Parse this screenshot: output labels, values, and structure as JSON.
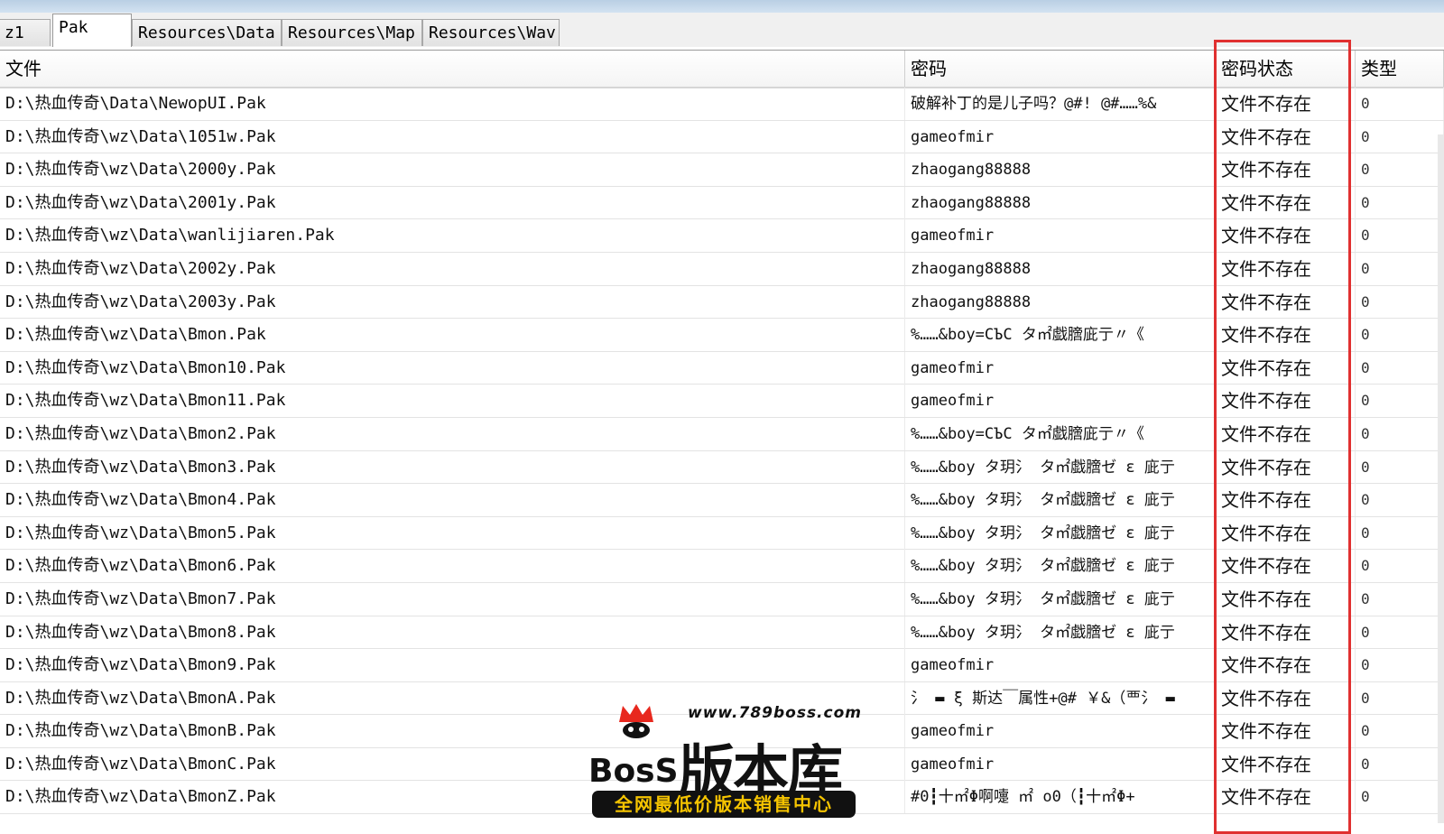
{
  "tabs": [
    {
      "label": "z1",
      "active": false
    },
    {
      "label": "Pak",
      "active": true
    },
    {
      "label": "Resources\\Data",
      "active": false
    },
    {
      "label": "Resources\\Map",
      "active": false
    },
    {
      "label": "Resources\\Wav",
      "active": false
    }
  ],
  "table": {
    "columns": [
      "文件",
      "密码",
      "密码状态",
      "类型"
    ],
    "rows": [
      {
        "file": "D:\\热血传奇\\Data\\NewopUI.Pak",
        "password": "破解补丁的是儿子吗？@#! @#……%&",
        "status": "文件不存在",
        "type": "0"
      },
      {
        "file": "D:\\热血传奇\\wz\\Data\\1051w.Pak",
        "password": "gameofmir",
        "status": "文件不存在",
        "type": "0"
      },
      {
        "file": "D:\\热血传奇\\wz\\Data\\2000y.Pak",
        "password": "zhaogang88888",
        "status": "文件不存在",
        "type": "0"
      },
      {
        "file": "D:\\热血传奇\\wz\\Data\\2001y.Pak",
        "password": "zhaogang88888",
        "status": "文件不存在",
        "type": "0"
      },
      {
        "file": "D:\\热血传奇\\wz\\Data\\wanlijiaren.Pak",
        "password": "gameofmir",
        "status": "文件不存在",
        "type": "0"
      },
      {
        "file": "D:\\热血传奇\\wz\\Data\\2002y.Pak",
        "password": "zhaogang88888",
        "status": "文件不存在",
        "type": "0"
      },
      {
        "file": "D:\\热血传奇\\wz\\Data\\2003y.Pak",
        "password": "zhaogang88888",
        "status": "文件不存在",
        "type": "0"
      },
      {
        "file": "D:\\热血传奇\\wz\\Data\\Bmon.Pak",
        "password": "%……&boy=CЪC   タ㎡戯膪庛亍〃《",
        "status": "文件不存在",
        "type": "0"
      },
      {
        "file": "D:\\热血传奇\\wz\\Data\\Bmon10.Pak",
        "password": "gameofmir",
        "status": "文件不存在",
        "type": "0"
      },
      {
        "file": "D:\\热血传奇\\wz\\Data\\Bmon11.Pak",
        "password": "gameofmir",
        "status": "文件不存在",
        "type": "0"
      },
      {
        "file": "D:\\热血传奇\\wz\\Data\\Bmon2.Pak",
        "password": "%……&boy=CЪC   タ㎡戯膪庛亍〃《",
        "status": "文件不存在",
        "type": "0"
      },
      {
        "file": "D:\\热血传奇\\wz\\Data\\Bmon3.Pak",
        "password": "%……&boy  タ玥氵  タ㎡戯膪ゼ ε 庛亍",
        "status": "文件不存在",
        "type": "0"
      },
      {
        "file": "D:\\热血传奇\\wz\\Data\\Bmon4.Pak",
        "password": "%……&boy  タ玥氵  タ㎡戯膪ゼ ε 庛亍",
        "status": "文件不存在",
        "type": "0"
      },
      {
        "file": "D:\\热血传奇\\wz\\Data\\Bmon5.Pak",
        "password": "%……&boy  タ玥氵  タ㎡戯膪ゼ ε 庛亍",
        "status": "文件不存在",
        "type": "0"
      },
      {
        "file": "D:\\热血传奇\\wz\\Data\\Bmon6.Pak",
        "password": "%……&boy  タ玥氵  タ㎡戯膪ゼ ε 庛亍",
        "status": "文件不存在",
        "type": "0"
      },
      {
        "file": "D:\\热血传奇\\wz\\Data\\Bmon7.Pak",
        "password": "%……&boy  タ玥氵  タ㎡戯膪ゼ ε 庛亍",
        "status": "文件不存在",
        "type": "0"
      },
      {
        "file": "D:\\热血传奇\\wz\\Data\\Bmon8.Pak",
        "password": "%……&boy  タ玥氵  タ㎡戯膪ゼ ε 庛亍",
        "status": "文件不存在",
        "type": "0"
      },
      {
        "file": "D:\\热血传奇\\wz\\Data\\Bmon9.Pak",
        "password": "gameofmir",
        "status": "文件不存在",
        "type": "0"
      },
      {
        "file": "D:\\热血传奇\\wz\\Data\\BmonA.Pak",
        "password": "氵 ▬ ξ 斯达￣属性+@#  ￥&（覀氵 ▬",
        "status": "文件不存在",
        "type": "0"
      },
      {
        "file": "D:\\热血传奇\\wz\\Data\\BmonB.Pak",
        "password": "gameofmir",
        "status": "文件不存在",
        "type": "0"
      },
      {
        "file": "D:\\热血传奇\\wz\\Data\\BmonC.Pak",
        "password": "gameofmir",
        "status": "文件不存在",
        "type": "0"
      },
      {
        "file": "D:\\热血传奇\\wz\\Data\\BmonZ.Pak",
        "password": "#0┇十㎡Φ啊嚏  ㎡   o0（┇十㎡Φ+",
        "status": "文件不存在",
        "type": "0"
      }
    ]
  },
  "watermark": {
    "url": "www.789boss.com",
    "boss": "BosS",
    "name": "版本库",
    "slogan": "全网最低价版本销售中心"
  }
}
